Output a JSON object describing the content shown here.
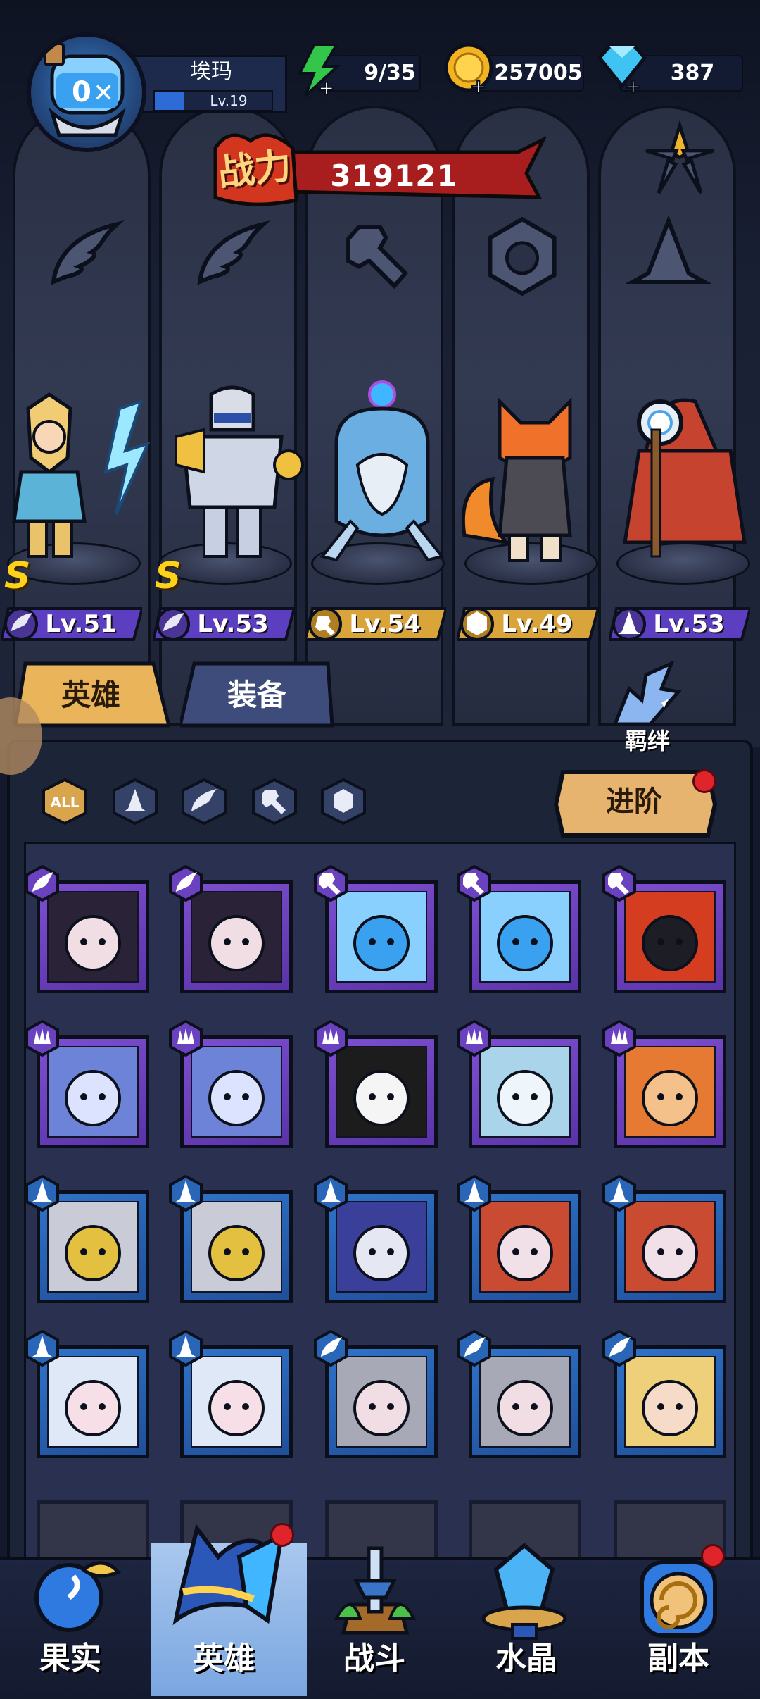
{
  "player": {
    "name": "埃玛",
    "level": "Lv.19",
    "level_progress": 0.25
  },
  "resources": {
    "energy": "9/35",
    "gold": "257005",
    "gems": "387"
  },
  "power": {
    "label": "战力",
    "value": "319121"
  },
  "heroes": [
    {
      "level": "Lv.51",
      "class_icon": "wing-icon",
      "rank": "S",
      "tag_color": "#5b3fc0"
    },
    {
      "level": "Lv.53",
      "class_icon": "wing-icon",
      "rank": "S",
      "tag_color": "#5b3fc0"
    },
    {
      "level": "Lv.54",
      "class_icon": "wrench-icon",
      "rank": "",
      "tag_color": "#d9a43a"
    },
    {
      "level": "Lv.49",
      "class_icon": "claw-icon",
      "rank": "",
      "tag_color": "#d9a43a"
    },
    {
      "level": "Lv.53",
      "class_icon": "wizard-hat-icon",
      "rank": "",
      "tag_color": "#5b3fc0"
    }
  ],
  "tabs": {
    "heroes": "英雄",
    "equipment": "装备"
  },
  "bond": "羁绊",
  "filters": [
    "ALL",
    "wizard-hat-icon",
    "wing-icon",
    "wrench-icon",
    "claw-icon"
  ],
  "advance_button": "进阶",
  "cards": [
    {
      "badge": "wing-icon",
      "frame": "purple",
      "portrait": "dark-haired-sorceress"
    },
    {
      "badge": "wing-icon",
      "frame": "purple",
      "portrait": "dark-haired-sorceress"
    },
    {
      "badge": "wrench-icon",
      "frame": "purple",
      "portrait": "fishbowl-robot"
    },
    {
      "badge": "wrench-icon",
      "frame": "purple",
      "portrait": "fishbowl-robot"
    },
    {
      "badge": "wrench-icon",
      "frame": "purple",
      "portrait": "diving-helmet"
    },
    {
      "badge": "claw-icon",
      "frame": "purple",
      "portrait": "blue-dragon"
    },
    {
      "badge": "claw-icon",
      "frame": "purple",
      "portrait": "blue-dragon"
    },
    {
      "badge": "claw-icon",
      "frame": "purple",
      "portrait": "panda"
    },
    {
      "badge": "claw-icon",
      "frame": "purple",
      "portrait": "white-bear"
    },
    {
      "badge": "claw-icon",
      "frame": "purple",
      "portrait": "fox"
    },
    {
      "badge": "wizard-hat-icon",
      "frame": "blue",
      "portrait": "armored-knight"
    },
    {
      "badge": "wizard-hat-icon",
      "frame": "blue",
      "portrait": "armored-knight"
    },
    {
      "badge": "wizard-hat-icon",
      "frame": "blue",
      "portrait": "blue-wizard"
    },
    {
      "badge": "wizard-hat-icon",
      "frame": "blue",
      "portrait": "red-hood-mage"
    },
    {
      "badge": "wizard-hat-icon",
      "frame": "blue",
      "portrait": "red-hood-mage"
    },
    {
      "badge": "wizard-hat-icon",
      "frame": "blue",
      "portrait": "white-haired-queen"
    },
    {
      "badge": "wizard-hat-icon",
      "frame": "blue",
      "portrait": "white-haired-queen"
    },
    {
      "badge": "wing-icon",
      "frame": "blue",
      "portrait": "pale-elf-lady"
    },
    {
      "badge": "wing-icon",
      "frame": "blue",
      "portrait": "pale-elf-lady"
    },
    {
      "badge": "wing-icon",
      "frame": "blue",
      "portrait": "blonde-princess"
    }
  ],
  "nav": [
    {
      "label": "果实",
      "icon": "fruit-icon"
    },
    {
      "label": "英雄",
      "icon": "hero-hat-icon",
      "active": true
    },
    {
      "label": "战斗",
      "icon": "battle-sword-icon"
    },
    {
      "label": "水晶",
      "icon": "crystal-icon"
    },
    {
      "label": "副本",
      "icon": "dungeon-portal-icon"
    }
  ],
  "colors": {
    "purple_frame": "#6a42c0",
    "blue_frame": "#2a66b8",
    "gold": "#e7b04a",
    "power_banner": "#b01e1e"
  }
}
